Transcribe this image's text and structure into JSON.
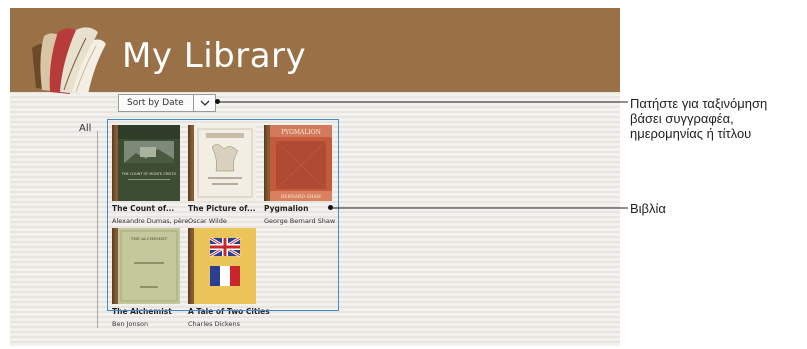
{
  "app": {
    "title": "My Library"
  },
  "sort": {
    "label": "Sort by Date"
  },
  "group": {
    "label": "All"
  },
  "books": [
    {
      "title": "The Count of...",
      "author": "Alexandre Dumas, père",
      "cover_color": "#4a5c3a",
      "cover_title": "THE COUNT OF MONTE CRISTO"
    },
    {
      "title": "The Picture of...",
      "author": "Oscar Wilde",
      "cover_color": "#f1ece2"
    },
    {
      "title": "Pygmalion",
      "author": "George Bernard Shaw",
      "cover_color": "#c45a3d",
      "cover_title": "PYGMALION",
      "cover_author": "BERNARD SHAW"
    },
    {
      "title": "The Alchemist",
      "author": "Ben Jonson",
      "cover_color": "#c2c69a",
      "cover_title": "THE ALCHEMIST"
    },
    {
      "title": "A Tale of Two Cities",
      "author": "Charles Dickens",
      "cover_color": "#e8c24f"
    }
  ],
  "callouts": {
    "sort_line1": "Πατήστε για ταξινόμηση",
    "sort_line2": "βάσει συγγραφέα,",
    "sort_line3": "ημερομηνίας ή τίτλου",
    "books": "Βιβλία"
  },
  "colors": {
    "header": "#9a7146",
    "selection": "#3f8fd0"
  }
}
